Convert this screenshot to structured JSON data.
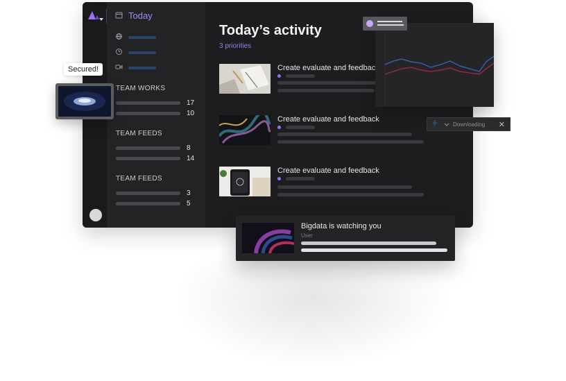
{
  "sidebar": {
    "today_label": "Today",
    "groups": [
      {
        "title": "TEAM WORKS",
        "rows": [
          {
            "count": "17"
          },
          {
            "count": "10"
          }
        ]
      },
      {
        "title": "TEAM FEEDS",
        "rows": [
          {
            "count": "8"
          },
          {
            "count": "14"
          }
        ]
      },
      {
        "title": "TEAM FEEDS",
        "rows": [
          {
            "count": "3"
          },
          {
            "count": "5"
          }
        ]
      }
    ],
    "icons": [
      "calendar-icon",
      "globe-icon",
      "clock-icon",
      "video-icon"
    ]
  },
  "main": {
    "title": "Today’s activity",
    "subtitle": "3 priorities",
    "activities": [
      {
        "title": "Create evaluate and feedback"
      },
      {
        "title": "Create evaluate and feedback"
      },
      {
        "title": "Create evaluate and feedback"
      }
    ]
  },
  "badge": {
    "secured": "Secured!"
  },
  "download": {
    "label": "Downloading"
  },
  "notification": {
    "title": "Bigdata is watching you",
    "subtitle": "User"
  },
  "colors": {
    "accent": "#9b6cf6",
    "window_bg": "#1d1d1f",
    "sidebar_bg": "#232325",
    "chart_line_blue": "#3b5aa6",
    "chart_line_red": "#8e2a43"
  }
}
